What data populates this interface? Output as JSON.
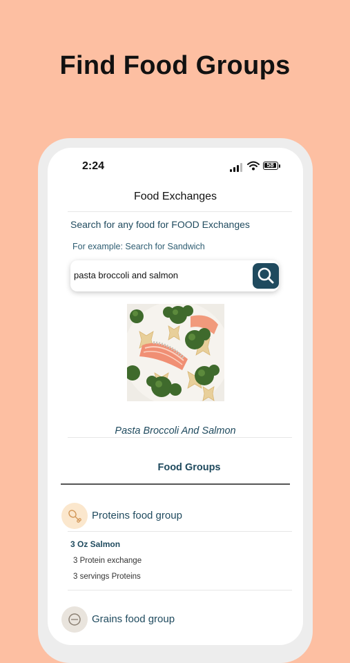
{
  "promo": {
    "headline": "Find Food Groups"
  },
  "status_bar": {
    "time": "2:24",
    "battery": "58"
  },
  "nav": {
    "title": "Food Exchanges"
  },
  "search": {
    "heading": "Search for any food for FOOD Exchanges",
    "hint": "For example: Search for Sandwich",
    "query": "pasta broccoli and salmon"
  },
  "result": {
    "caption": "Pasta Broccoli And Salmon"
  },
  "food_groups": {
    "heading": "Food Groups",
    "groups": [
      {
        "label": "Proteins food group",
        "icon": "drumstick-icon",
        "item": {
          "name": "3 Oz Salmon",
          "exchange": "3 Protein exchange",
          "servings": "3 servings Proteins"
        }
      },
      {
        "label": "Grains food group",
        "icon": "grain-icon"
      }
    ]
  },
  "colors": {
    "background": "#FDBFA2",
    "accent": "#1F4A5E",
    "protein_icon_bg": "#FBE7CD",
    "grain_icon_bg": "#E9E4DD"
  }
}
